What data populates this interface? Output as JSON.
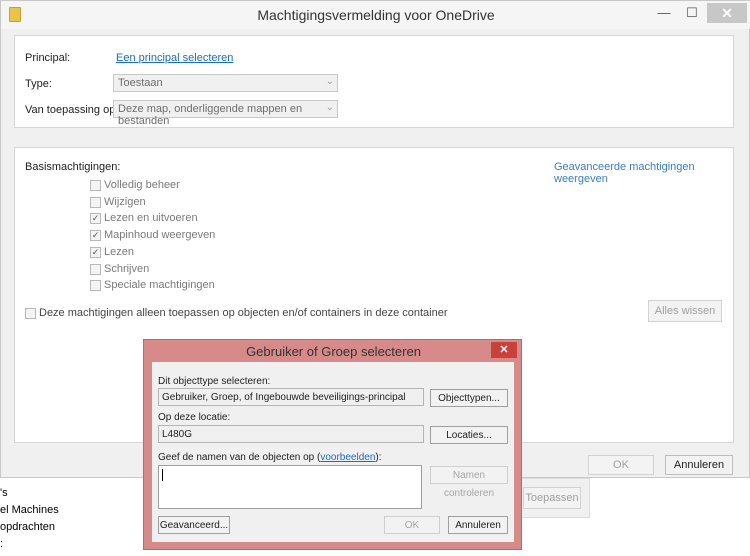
{
  "background_window": {
    "items": [
      "'s",
      "el Machines",
      "opdrachten",
      ":"
    ],
    "apply_label": "Toepassen"
  },
  "main": {
    "title": "Machtigingsvermelding voor OneDrive",
    "window_controls": {
      "minimize": "—",
      "maximize": "☐",
      "close": "✕"
    },
    "principal_label": "Principal:",
    "principal_link": "Een principal selecteren",
    "type_label": "Type:",
    "type_value": "Toestaan",
    "applies_label": "Van toepassing op:",
    "applies_value": "Deze map, onderliggende mappen en bestanden",
    "basic_perms_label": "Basismachtigingen:",
    "advanced_link": "Geavanceerde machtigingen weergeven",
    "permissions": [
      {
        "label": "Volledig beheer",
        "checked": false
      },
      {
        "label": "Wijzigen",
        "checked": false
      },
      {
        "label": "Lezen en uitvoeren",
        "checked": true
      },
      {
        "label": "Mapinhoud weergeven",
        "checked": true
      },
      {
        "label": "Lezen",
        "checked": true
      },
      {
        "label": "Schrijven",
        "checked": false
      },
      {
        "label": "Speciale machtigingen",
        "checked": false
      }
    ],
    "only_apply_label": "Deze machtigingen alleen toepassen op objecten en/of containers in deze container",
    "clear_all": "Alles wissen",
    "ok": "OK",
    "cancel": "Annuleren"
  },
  "select_dialog": {
    "title": "Gebruiker of Groep selecteren",
    "close": "✕",
    "objtype_label": "Dit objecttype selecteren:",
    "objtype_value": "Gebruiker, Groep, of Ingebouwde beveiligings-principal",
    "objtypes_btn": "Objecttypen...",
    "location_label": "Op deze locatie:",
    "location_value": "L480G",
    "locations_btn": "Locaties...",
    "names_label_prefix": "Geef de namen van de objecten op (",
    "names_label_link": "voorbeelden",
    "names_label_suffix": "):",
    "check_names_btn": "Namen controleren",
    "advanced_btn": "Geavanceerd...",
    "ok": "OK",
    "cancel": "Annuleren"
  }
}
